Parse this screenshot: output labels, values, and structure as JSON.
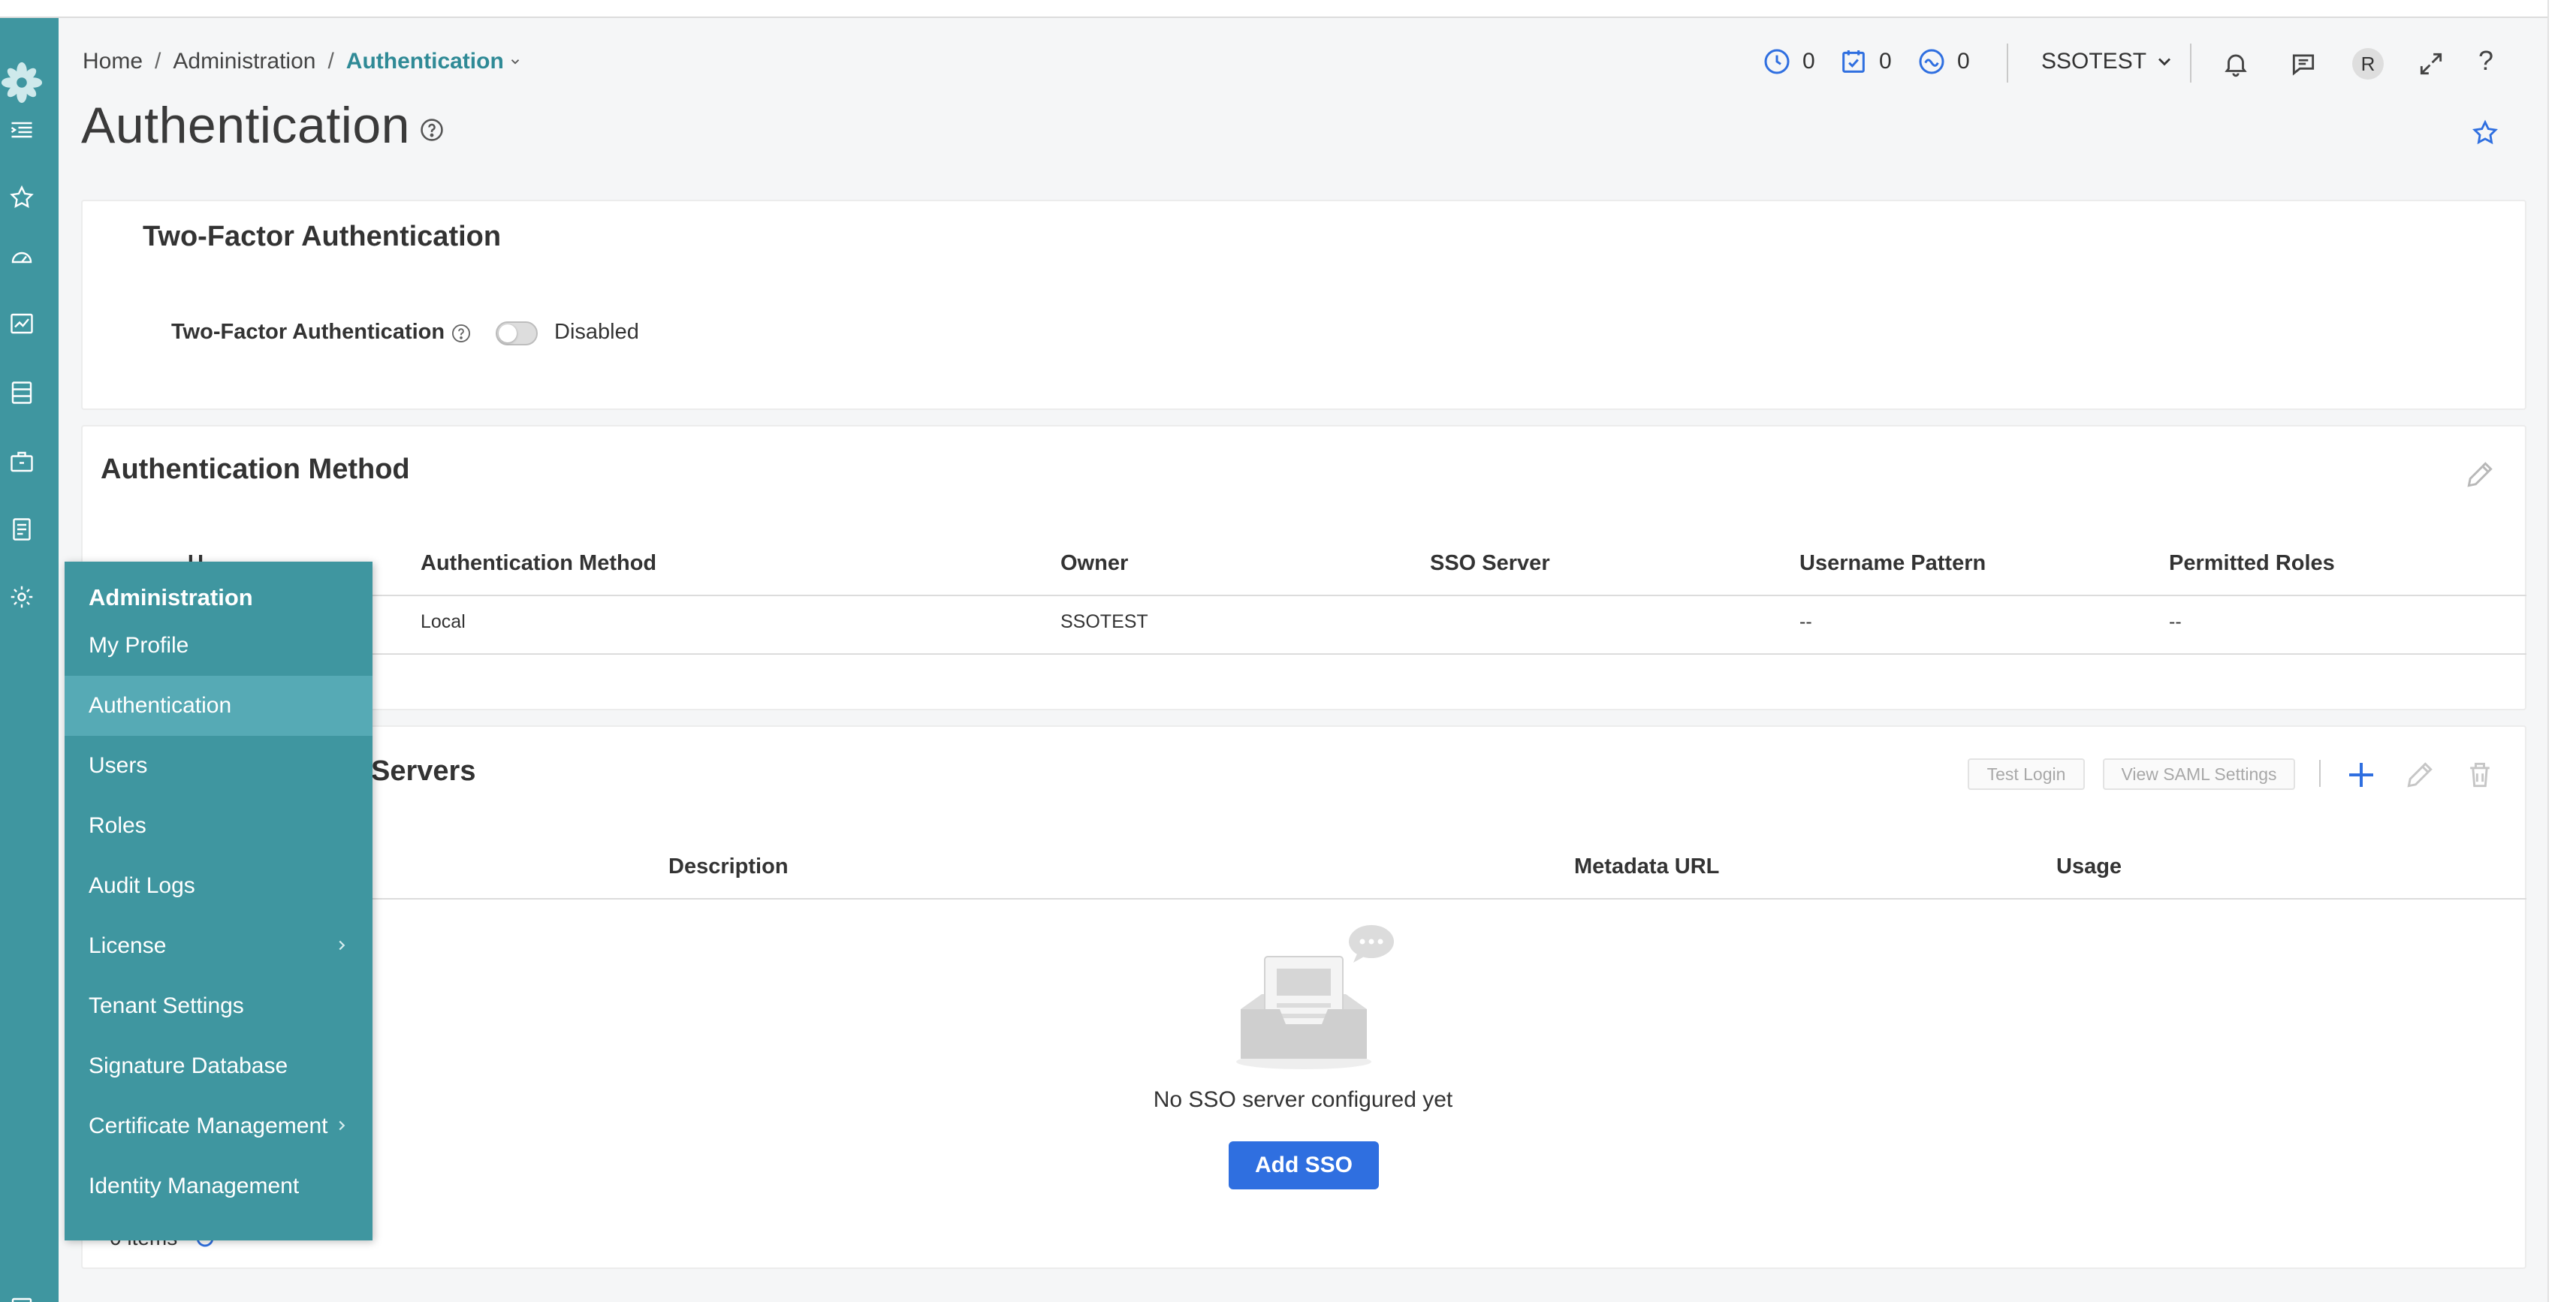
{
  "header": {
    "breadcrumb": [
      "Home",
      "Administration",
      "Authentication"
    ],
    "counters": [
      {
        "icon": "clock-icon",
        "value": "0"
      },
      {
        "icon": "calendar-check-icon",
        "value": "0"
      },
      {
        "icon": "wave-icon",
        "value": "0"
      }
    ],
    "tenant": "SSOTEST",
    "avatar_initial": "R"
  },
  "page": {
    "title": "Authentication"
  },
  "two_factor": {
    "title": "Two-Factor Authentication",
    "label": "Two-Factor Authentication",
    "status": "Disabled",
    "enabled": false
  },
  "auth_method": {
    "title": "Authentication Method",
    "columns": [
      "U",
      "Authentication Method",
      "Owner",
      "SSO Server",
      "Username Pattern",
      "Permitted Roles"
    ],
    "rows": [
      [
        "",
        "Local",
        "SSOTEST",
        "",
        "--",
        "--"
      ]
    ]
  },
  "sso": {
    "title": "Servers",
    "buttons": {
      "test_login": "Test Login",
      "view_saml": "View SAML Settings"
    },
    "columns": [
      "Description",
      "Metadata URL",
      "Usage"
    ],
    "empty_message": "No SSO server configured yet",
    "add_button": "Add SSO",
    "items_count": "0 items"
  },
  "menu": {
    "heading": "Administration",
    "items": [
      {
        "label": "My Profile",
        "has_submenu": false
      },
      {
        "label": "Authentication",
        "has_submenu": false,
        "active": true
      },
      {
        "label": "Users",
        "has_submenu": false
      },
      {
        "label": "Roles",
        "has_submenu": false
      },
      {
        "label": "Audit Logs",
        "has_submenu": false
      },
      {
        "label": "License",
        "has_submenu": true
      },
      {
        "label": "Tenant Settings",
        "has_submenu": false
      },
      {
        "label": "Signature Database",
        "has_submenu": false
      },
      {
        "label": "Certificate Management",
        "has_submenu": true
      },
      {
        "label": "Identity Management",
        "has_submenu": false
      }
    ]
  },
  "colors": {
    "rail": "#3f96a0",
    "accent": "#2f8a96",
    "primary_button": "#2f6fe0",
    "icon_blue": "#2f6fe0"
  }
}
